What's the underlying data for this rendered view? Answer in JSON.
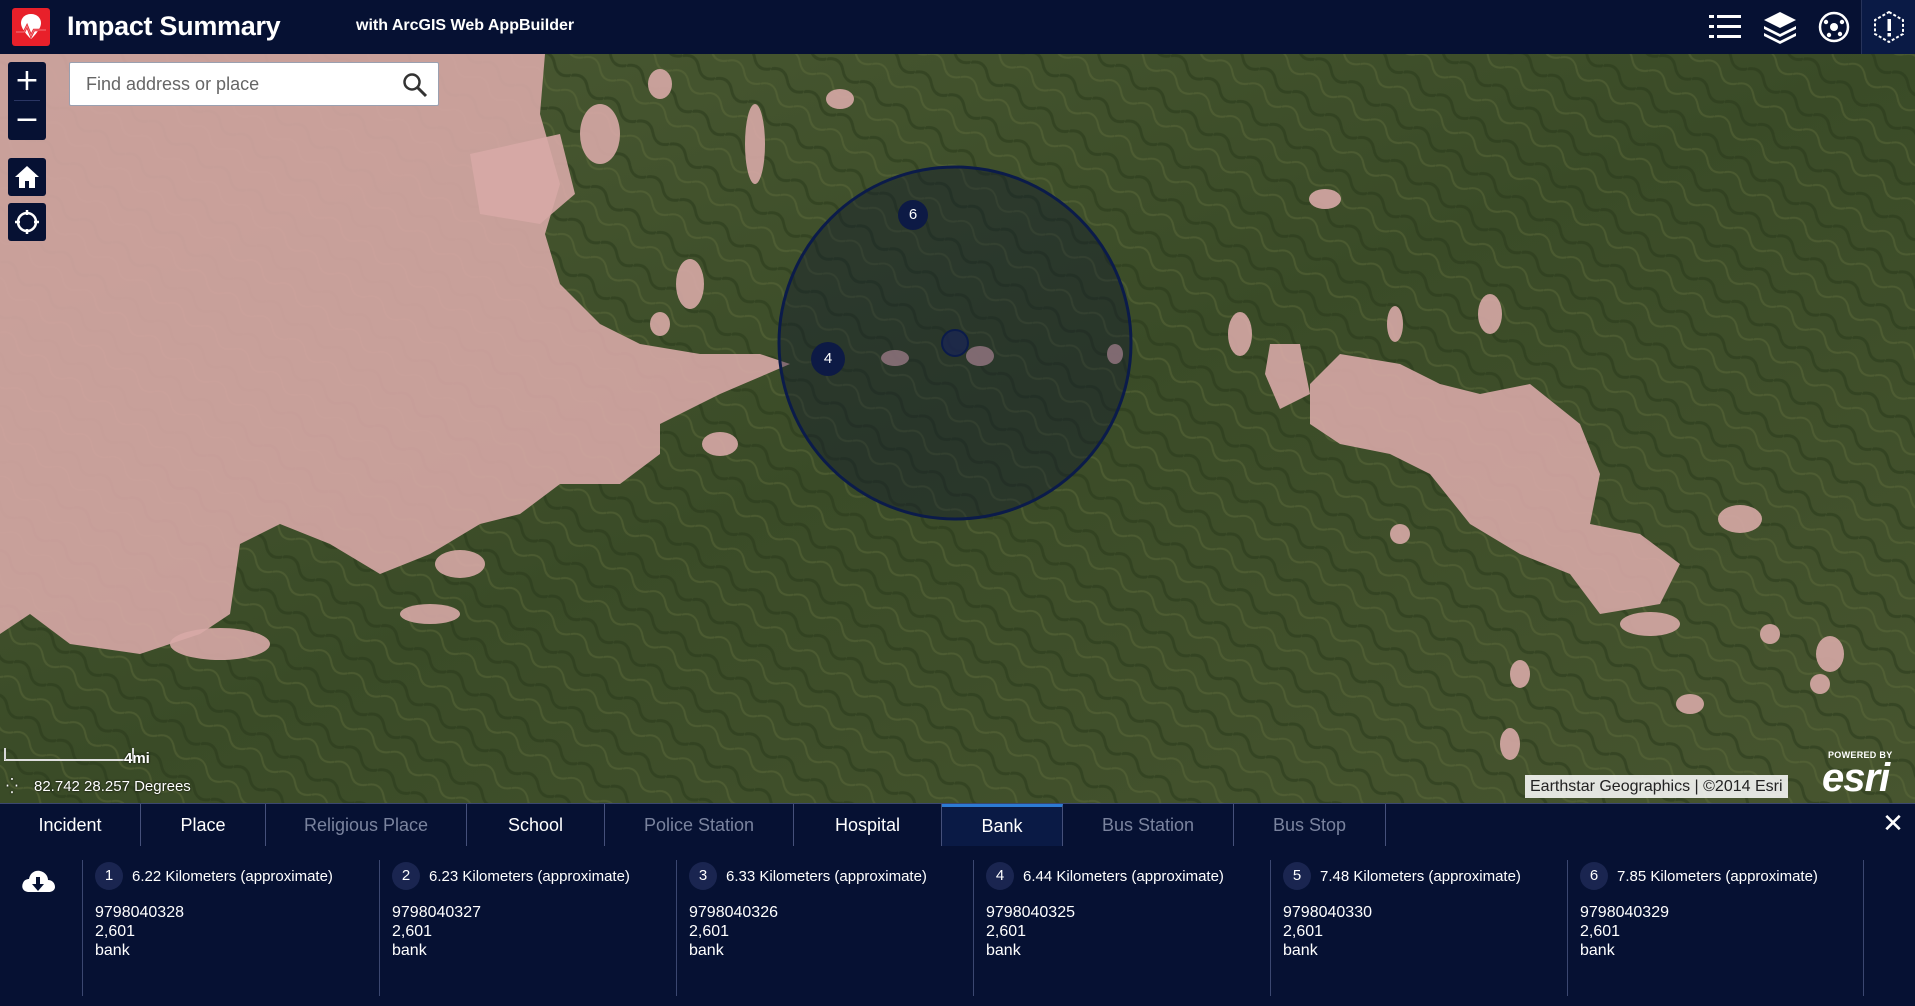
{
  "header": {
    "title": "Impact Summary",
    "subtitle": "with ArcGIS Web AppBuilder"
  },
  "search": {
    "placeholder": "Find address or place"
  },
  "map": {
    "zoom_in": "+",
    "zoom_out": "−",
    "coordinates": "82.742 28.257 Degrees",
    "scale_label": "4mi",
    "attribution": "Earthstar Geographics | ©2014 Esri",
    "powered_by": "POWERED BY",
    "esri": "esri",
    "markers": [
      {
        "label": "6"
      },
      {
        "label": "4"
      }
    ]
  },
  "panel": {
    "close": "✕",
    "tabs": [
      {
        "label": "Incident",
        "state": "normal"
      },
      {
        "label": "Place",
        "state": "normal"
      },
      {
        "label": "Religious Place",
        "state": "disabled"
      },
      {
        "label": "School",
        "state": "normal"
      },
      {
        "label": "Police Station",
        "state": "disabled"
      },
      {
        "label": "Hospital",
        "state": "normal"
      },
      {
        "label": "Bank",
        "state": "active"
      },
      {
        "label": "Bus Station",
        "state": "disabled"
      },
      {
        "label": "Bus Stop",
        "state": "disabled"
      }
    ],
    "results": [
      {
        "num": "1",
        "distance": "6.22 Kilometers (approximate)",
        "id": "9798040328",
        "value": "2,601",
        "type": "bank"
      },
      {
        "num": "2",
        "distance": "6.23 Kilometers (approximate)",
        "id": "9798040327",
        "value": "2,601",
        "type": "bank"
      },
      {
        "num": "3",
        "distance": "6.33 Kilometers (approximate)",
        "id": "9798040326",
        "value": "2,601",
        "type": "bank"
      },
      {
        "num": "4",
        "distance": "6.44 Kilometers (approximate)",
        "id": "9798040325",
        "value": "2,601",
        "type": "bank"
      },
      {
        "num": "5",
        "distance": "7.48 Kilometers (approximate)",
        "id": "9798040330",
        "value": "2,601",
        "type": "bank"
      },
      {
        "num": "6",
        "distance": "7.85 Kilometers (approximate)",
        "id": "9798040329",
        "value": "2,601",
        "type": "bank"
      }
    ]
  },
  "colors": {
    "header_bg": "#061133",
    "tab_active_border": "#2c7bd4",
    "logo_red": "#e8202a",
    "hazard_overlay": "#d7a9a6"
  }
}
